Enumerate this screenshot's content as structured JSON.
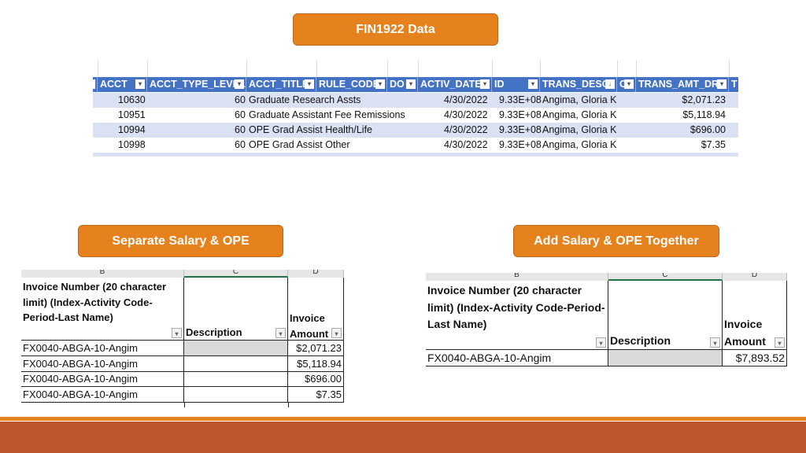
{
  "buttons": {
    "title": "FIN1922 Data",
    "separate": "Separate Salary & OPE",
    "together": "Add Salary & OPE Together"
  },
  "source_table": {
    "headers": [
      "ACCT",
      "ACCT_TYPE_LEVEL",
      "ACCT_TITLE",
      "RULE_CODE",
      "DO",
      "ACTIV_DATE",
      "ID",
      "TRANS_DESC",
      "C",
      "TRANS_AMT_DR",
      "T"
    ],
    "rows": [
      {
        "acct": "10630",
        "level": "60",
        "title": "Graduate Research Assts",
        "date": "4/30/2022",
        "id": "9.33E+08",
        "desc": "Angima, Gloria Kemu",
        "amt": "$2,071.23"
      },
      {
        "acct": "10951",
        "level": "60",
        "title": "Graduate Assistant Fee Remissions",
        "date": "4/30/2022",
        "id": "9.33E+08",
        "desc": "Angima, Gloria Kemu",
        "amt": "$5,118.94"
      },
      {
        "acct": "10994",
        "level": "60",
        "title": "OPE Grad Assist Health/Life",
        "date": "4/30/2022",
        "id": "9.33E+08",
        "desc": "Angima, Gloria Kemu",
        "amt": "$696.00"
      },
      {
        "acct": "10998",
        "level": "60",
        "title": "OPE Grad Assist Other",
        "date": "4/30/2022",
        "id": "9.33E+08",
        "desc": "Angima, Gloria Kemu",
        "amt": "$7.35"
      }
    ]
  },
  "invoice": {
    "col_letters": [
      "B",
      "C",
      "D"
    ],
    "h_invoice_number": "Invoice Number (20 character limit) (Index-Activity Code-Period-Last Name)",
    "h_description": "Description",
    "h_amount": "Invoice Amount",
    "separate_rows": [
      {
        "number": "FX0040-ABGA-10-Angim",
        "amount": "$2,071.23"
      },
      {
        "number": "FX0040-ABGA-10-Angim",
        "amount": "$5,118.94"
      },
      {
        "number": "FX0040-ABGA-10-Angim",
        "amount": "$696.00"
      },
      {
        "number": "FX0040-ABGA-10-Angim",
        "amount": "$7.35"
      }
    ],
    "together_rows": [
      {
        "number": "FX0040-ABGA-10-Angim",
        "amount": "$7,893.52"
      }
    ]
  },
  "colors": {
    "accent": "#e6821e",
    "footer": "#c0562b",
    "table_header": "#4472c4",
    "band": "#d9e1f2"
  }
}
